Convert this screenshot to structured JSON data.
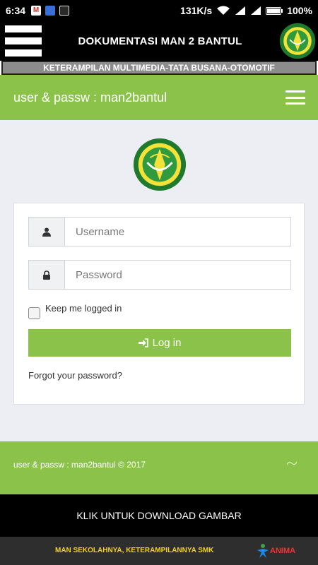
{
  "status_bar": {
    "time": "6:34",
    "gmail_letter": "M",
    "net_speed": "131K/s",
    "battery": "100%",
    "icons": [
      "gmail-icon",
      "app-icon",
      "app-icon",
      "wifi-icon",
      "signal-icon",
      "battery-icon"
    ]
  },
  "app_header": {
    "title": "DOKUMENTASI MAN 2 BANTUL"
  },
  "ticker": {
    "text": "KETERAMPILAN MULTIMEDIA-TATA BUSANA-OTOMOTIF"
  },
  "page_header": {
    "brand": "user & passw : man2bantul"
  },
  "login": {
    "username_placeholder": "Username",
    "password_placeholder": "Password",
    "remember_label": "Keep me logged in",
    "login_label": "Log in",
    "forgot_label": "Forgot your password?"
  },
  "footer": {
    "copyright": "user & passw : man2bantul © 2017"
  },
  "download_bar": {
    "label": "KLIK UNTUK DOWNLOAD GAMBAR"
  },
  "bottom_bar": {
    "slogan": "MAN SEKOLAHNYA, KETERAMPILANNYA SMK",
    "logo_text": "ANIMA"
  },
  "colors": {
    "accent_green": "#8bc34a",
    "background": "#eceef3",
    "slogan_yellow": "#f2d21b"
  }
}
